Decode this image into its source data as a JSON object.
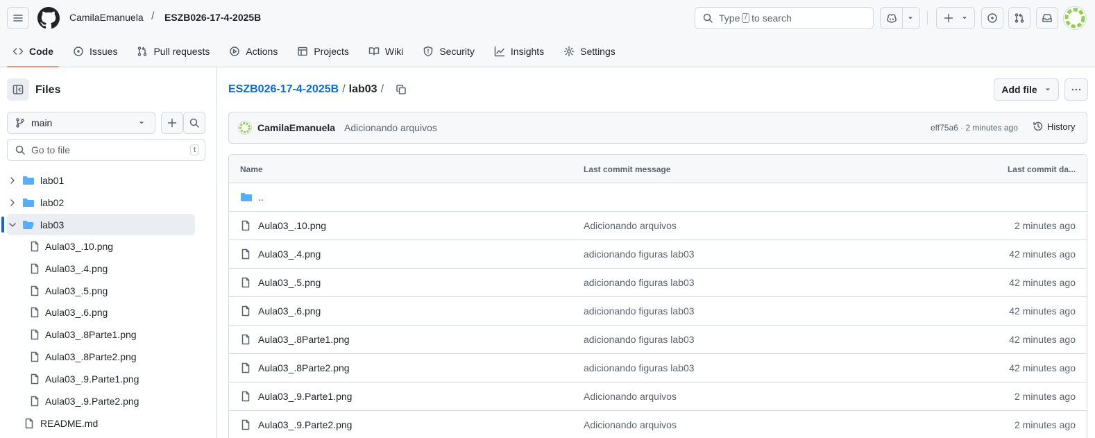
{
  "header": {
    "owner": "CamilaEmanuela",
    "separator": "/",
    "repo": "ESZB026-17-4-2025B",
    "search": {
      "prefix": "Type",
      "key": "/",
      "suffix": "to search"
    },
    "icons": [
      "menu-icon",
      "github-logo",
      "search-icon",
      "copilot-icon",
      "plus-icon",
      "issue-icon",
      "pull-request-icon",
      "inbox-icon",
      "avatar"
    ]
  },
  "tabs": [
    {
      "label": "Code",
      "icon": "code-icon",
      "active": true
    },
    {
      "label": "Issues",
      "icon": "issue-icon"
    },
    {
      "label": "Pull requests",
      "icon": "pull-request-icon"
    },
    {
      "label": "Actions",
      "icon": "play-icon"
    },
    {
      "label": "Projects",
      "icon": "table-icon"
    },
    {
      "label": "Wiki",
      "icon": "book-icon"
    },
    {
      "label": "Security",
      "icon": "shield-icon"
    },
    {
      "label": "Insights",
      "icon": "graph-icon"
    },
    {
      "label": "Settings",
      "icon": "gear-icon"
    }
  ],
  "sidebar": {
    "title": "Files",
    "branch": "main",
    "goto_placeholder": "Go to file",
    "goto_key": "t",
    "tree": [
      {
        "label": "lab01",
        "type": "folder",
        "expanded": false
      },
      {
        "label": "lab02",
        "type": "folder",
        "expanded": false
      },
      {
        "label": "lab03",
        "type": "folder",
        "expanded": true,
        "selected": true
      },
      {
        "label": "Aula03_.10.png",
        "type": "file",
        "child": true
      },
      {
        "label": "Aula03_.4.png",
        "type": "file",
        "child": true
      },
      {
        "label": "Aula03_.5.png",
        "type": "file",
        "child": true
      },
      {
        "label": "Aula03_.6.png",
        "type": "file",
        "child": true
      },
      {
        "label": "Aula03_.8Parte1.png",
        "type": "file",
        "child": true
      },
      {
        "label": "Aula03_.8Parte2.png",
        "type": "file",
        "child": true
      },
      {
        "label": "Aula03_.9.Parte1.png",
        "type": "file",
        "child": true
      },
      {
        "label": "Aula03_.9.Parte2.png",
        "type": "file",
        "child": true
      },
      {
        "label": "README.md",
        "type": "file",
        "child": false
      }
    ]
  },
  "main": {
    "breadcrumb": {
      "repo": "ESZB026-17-4-2025B",
      "folder": "lab03",
      "sep": "/"
    },
    "add_file": "Add file",
    "commit": {
      "author": "CamilaEmanuela",
      "message": "Adicionando arquivos",
      "meta": "eff75a6 · 2 minutes ago",
      "history": "History"
    },
    "table": {
      "headers": {
        "name": "Name",
        "message": "Last commit message",
        "date": "Last commit da..."
      },
      "parent": "..",
      "rows": [
        {
          "name": "Aula03_.10.png",
          "message": "Adicionando arquivos",
          "date": "2 minutes ago"
        },
        {
          "name": "Aula03_.4.png",
          "message": "adicionando figuras lab03",
          "date": "42 minutes ago"
        },
        {
          "name": "Aula03_.5.png",
          "message": "adicionando figuras lab03",
          "date": "42 minutes ago"
        },
        {
          "name": "Aula03_.6.png",
          "message": "adicionando figuras lab03",
          "date": "42 minutes ago"
        },
        {
          "name": "Aula03_.8Parte1.png",
          "message": "adicionando figuras lab03",
          "date": "42 minutes ago"
        },
        {
          "name": "Aula03_.8Parte2.png",
          "message": "adicionando figuras lab03",
          "date": "42 minutes ago"
        },
        {
          "name": "Aula03_.9.Parte1.png",
          "message": "Adicionando arquivos",
          "date": "2 minutes ago"
        },
        {
          "name": "Aula03_.9.Parte2.png",
          "message": "Adicionando arquivos",
          "date": "2 minutes ago"
        }
      ]
    }
  },
  "colors": {
    "accent": "#0969da",
    "tab_underline": "#fd8c73",
    "folder": "#54aeff",
    "avatar": "#8fd14f"
  }
}
